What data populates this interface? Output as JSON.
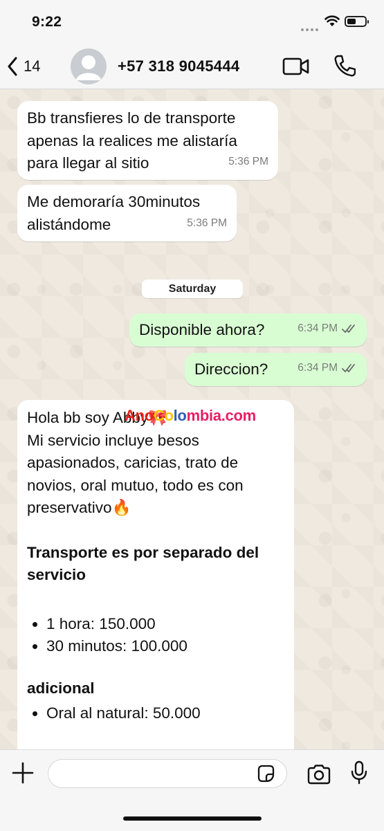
{
  "status_bar": {
    "time": "9:22"
  },
  "header": {
    "back_count": "14",
    "contact_name": "+57 318 9045444"
  },
  "messages": [
    {
      "direction": "in",
      "text": "Bb transfieres lo de transporte\napenas la realices me alistaría\npara llegar al sitio",
      "time": "5:36 PM"
    },
    {
      "direction": "in",
      "text": "Me demoraría 30minutos\nalistándome",
      "time": "5:36 PM"
    },
    {
      "direction": "out",
      "text": "Disponible ahora?",
      "time": "6:34 PM",
      "status": "read"
    },
    {
      "direction": "out",
      "text": "Direccion?",
      "time": "6:34 PM",
      "status": "read"
    }
  ],
  "date_separator": "Saturday",
  "long_message": {
    "intro": "Hola bb soy Abby🎀\nMi servicio incluye besos\napasionados, caricias, trato de\nnovios, oral mutuo, todo es con\npreservativo🔥",
    "heading": "Transporte es por separado del\nservicio",
    "prices": [
      "1 hora: 150.000",
      "30 minutos: 100.000"
    ],
    "additional_heading": "adicional",
    "additional": [
      "Oral al natural: 50.000"
    ]
  },
  "watermark": {
    "part1": "Ano",
    "part2": "Co",
    "part3": "lo",
    "part4": "mbia.com"
  },
  "composer": {
    "placeholder": ""
  },
  "colors": {
    "incoming_bubble": "#ffffff",
    "outgoing_bubble": "#d9fdd3",
    "read_ticks": "#53bdeb",
    "chat_background": "#efe9df"
  }
}
